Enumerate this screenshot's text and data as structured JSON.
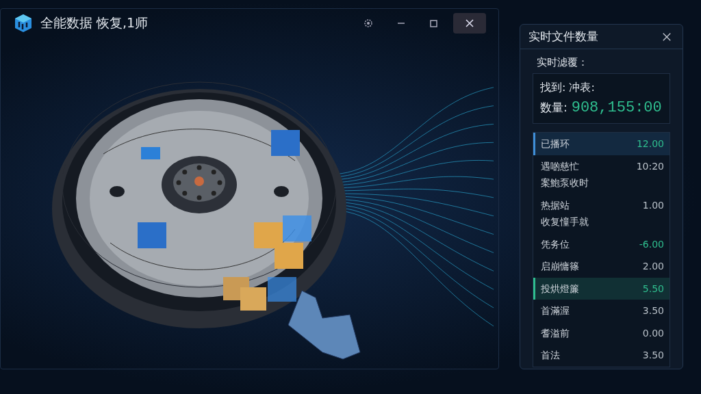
{
  "window": {
    "title": "全能数据 恢复,1师"
  },
  "panel": {
    "title": "实时文件数量",
    "subtitle": "实时滤覆：",
    "found_label": "找到: 冲表:",
    "count_label": "数量:",
    "count_value": "908,155:00",
    "rows": [
      {
        "label": [
          "已播环"
        ],
        "value": "12.00",
        "selected": true,
        "color": "#3f8fd8",
        "positive": true
      },
      {
        "label": [
          "遇啲慈忙",
          "案鮑泵收时"
        ],
        "value": "10:20",
        "selected": false,
        "positive": false
      },
      {
        "label": [
          "热据站",
          "收复憧手就"
        ],
        "value": "1.00",
        "selected": false,
        "positive": false
      },
      {
        "label": [
          "凭务位"
        ],
        "value": "-6.00",
        "selected": false,
        "positive": true
      },
      {
        "label": [
          "启崩慵篠"
        ],
        "value": "2.00",
        "selected": false,
        "positive": false
      },
      {
        "label": [
          "投烘燈簾"
        ],
        "value": "5.50",
        "selected": true,
        "color": "#2fbf8f",
        "positive": true
      },
      {
        "label": [
          "首滿渥"
        ],
        "value": "3.50",
        "selected": false,
        "positive": false
      },
      {
        "label": [
          "耆溢前"
        ],
        "value": "0.00",
        "selected": false,
        "positive": false
      },
      {
        "label": [
          "首法"
        ],
        "value": "3.50",
        "selected": false,
        "positive": false
      }
    ]
  }
}
